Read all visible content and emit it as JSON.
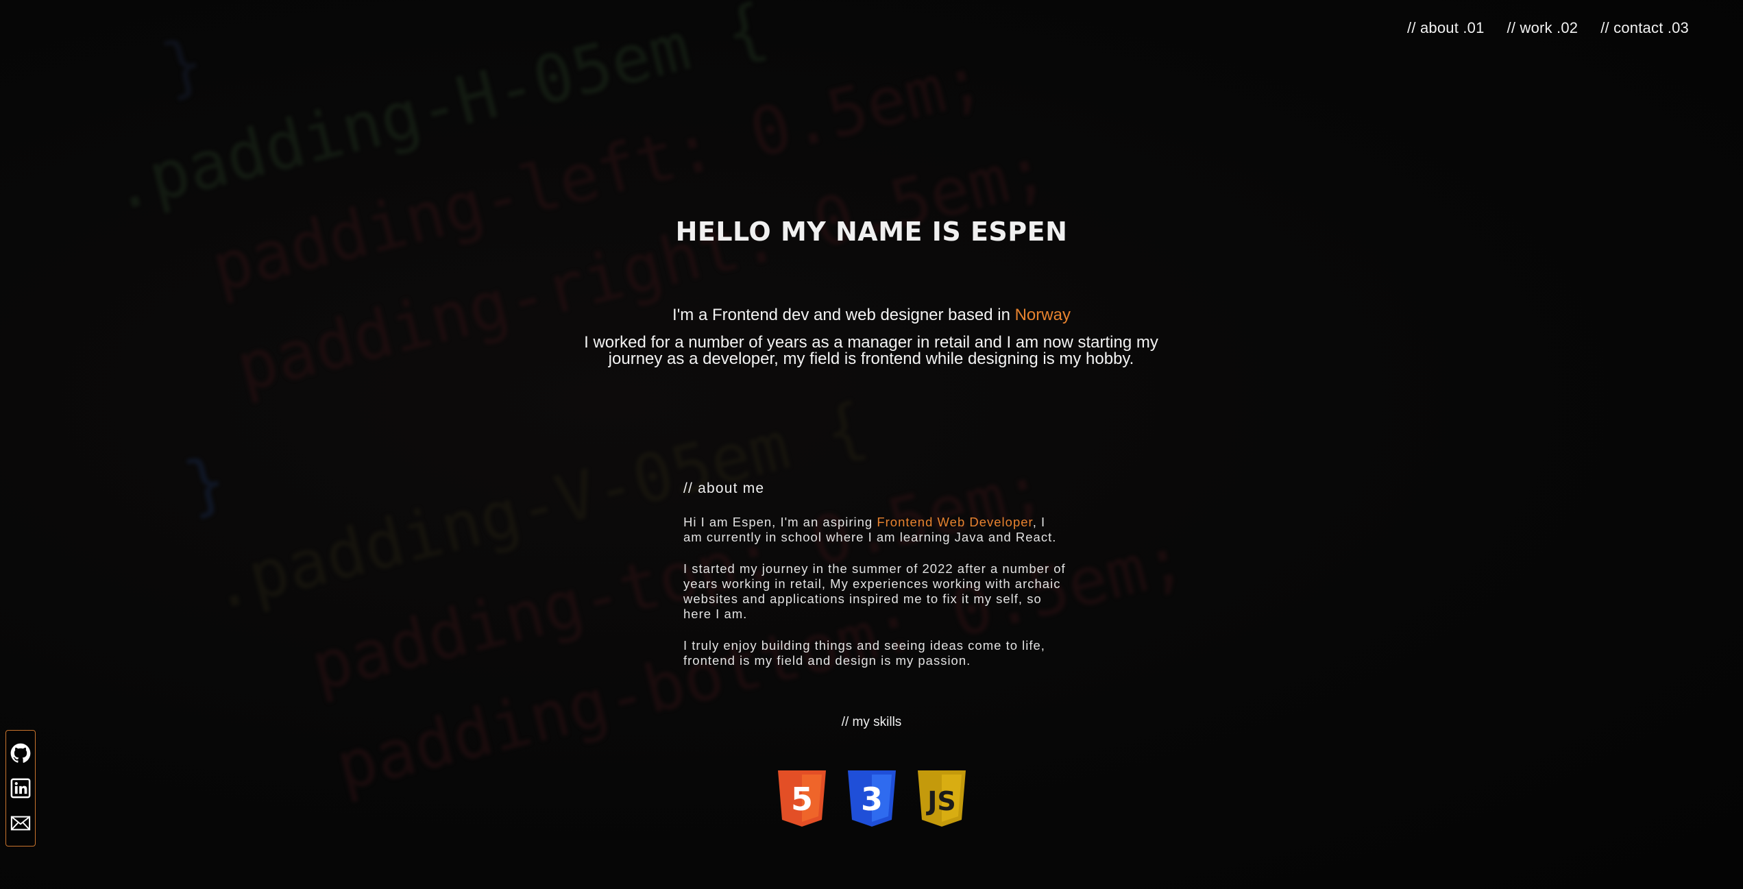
{
  "nav": {
    "items": [
      {
        "label": "// about .01"
      },
      {
        "label": "// work .02"
      },
      {
        "label": "// contact .03"
      }
    ]
  },
  "hero": {
    "title": "HELLO MY NAME IS ESPEN",
    "intro_prefix": "I'm a Frontend dev and web designer based in ",
    "intro_highlight": "Norway",
    "description": "I worked for a number of years as a manager in retail and I am now starting my journey as a developer, my field is frontend while designing is my hobby."
  },
  "about": {
    "heading": "// about me",
    "p1_prefix": "Hi I am Espen, I'm an aspiring ",
    "p1_highlight": "Frontend Web Developer",
    "p1_suffix": ", I am currently in school where I am learning Java and React.",
    "p2": "I started my journey in the summer of 2022 after a number of years working in retail, My experiences working with archaic websites and applications inspired me to fix it my self, so here I am.",
    "p3": "I truly enjoy building things and seeing ideas come to life, frontend is my field and design is my passion."
  },
  "skills": {
    "heading": "// my skills",
    "items": [
      {
        "icon": "html5-icon",
        "glyph": "5",
        "color": "#e34f26",
        "color_light": "#ef652a"
      },
      {
        "icon": "css3-icon",
        "glyph": "3",
        "color": "#1572b6",
        "color_light": "#33a9dc"
      },
      {
        "icon": "javascript-icon",
        "glyph": "JS",
        "color": "#d4a90f",
        "color_light": "#f0c419"
      }
    ]
  },
  "social": {
    "items": [
      {
        "icon": "github-icon"
      },
      {
        "icon": "linkedin-icon"
      },
      {
        "icon": "mail-icon"
      }
    ]
  },
  "colors": {
    "accent": "#e8832f",
    "background": "#050505",
    "text": "#f0f0f0"
  },
  "background_code": [
    "    }",
    "  .padding-H-05em {",
    "    padding-left: 0.5em;",
    "    padding-right: 0.5em;",
    "  }",
    "  .padding-V-05em {",
    "    padding-top: 0.5em;",
    "    padding-bottom: 0.5em;"
  ]
}
